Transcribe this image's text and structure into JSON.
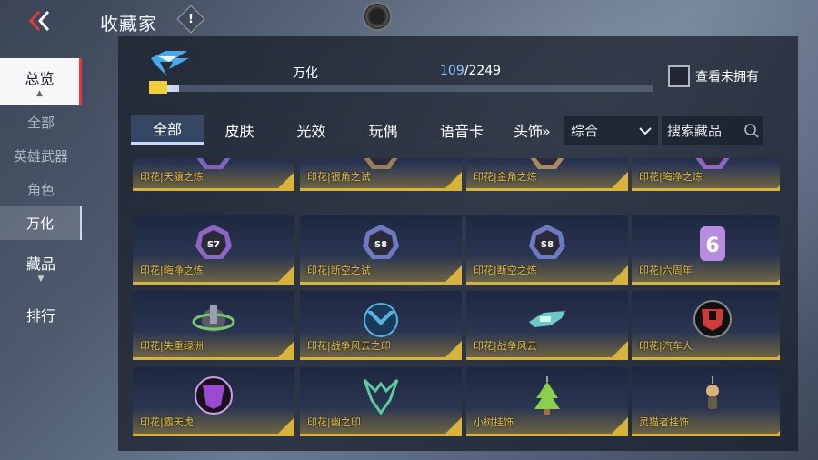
{
  "header": {
    "title": "收藏家",
    "info_label": "!"
  },
  "sidebar": {
    "overview": "总览",
    "sub_items": [
      "全部",
      "英雄武器",
      "角色",
      "万化"
    ],
    "items_label": "藏品",
    "ranking": "排行"
  },
  "progress": {
    "name": "万化",
    "owned": "109",
    "total": "/2249",
    "fraction": 0.0485
  },
  "show_unowned_label": "查看未拥有",
  "tabs": [
    "全部",
    "皮肤",
    "光效",
    "玩偶",
    "语音卡",
    "头饰"
  ],
  "more_symbol": "»",
  "filter": {
    "selected": "综合"
  },
  "search": {
    "placeholder": "搜索藏品"
  },
  "items": [
    {
      "label": "印花|天骧之炼",
      "icon": "s5-badge-icon",
      "color": "#8a6fd0"
    },
    {
      "label": "印花|银角之试",
      "icon": "s6-badge-icon",
      "color": "#b08a55"
    },
    {
      "label": "印花|金角之炼",
      "icon": "s6-badge-icon",
      "color": "#c09a60"
    },
    {
      "label": "印花|晦净之炼",
      "icon": "s7-badge-icon",
      "color": "#a070d8"
    },
    {
      "label": "印花|晦净之炼",
      "icon": "s7-badge-icon",
      "color": "#a070d8"
    },
    {
      "label": "印花|断空之试",
      "icon": "s8-badge-icon",
      "color": "#7a88d8"
    },
    {
      "label": "印花|断空之炼",
      "icon": "s8-badge-icon",
      "color": "#7a88d8"
    },
    {
      "label": "印花|六周年",
      "icon": "six-anniversary-icon",
      "color": "#b78de0"
    },
    {
      "label": "印花|失重绿洲",
      "icon": "planet-ring-icon",
      "color": "#7bc96b"
    },
    {
      "label": "印花|战争风云之印",
      "icon": "shield-wing-icon",
      "color": "#5ab0e0"
    },
    {
      "label": "印花|战争风云",
      "icon": "gunship-icon",
      "color": "#6fc8c8"
    },
    {
      "label": "印花|汽车人",
      "icon": "autobot-icon",
      "color": "#d23a3a"
    },
    {
      "label": "印花|霸天虎",
      "icon": "decepticon-icon",
      "color": "#9a4ad0"
    },
    {
      "label": "印花|幽之印",
      "icon": "horned-crest-icon",
      "color": "#5fc8a0"
    },
    {
      "label": "小树挂饰",
      "icon": "tree-charm-icon",
      "color": "#8ad04a"
    },
    {
      "label": "灵猫者挂饰",
      "icon": "cat-charm-icon",
      "color": "#d8b47a"
    }
  ]
}
